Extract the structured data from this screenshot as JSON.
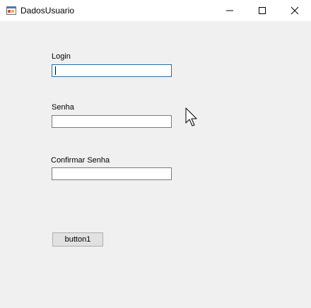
{
  "window": {
    "title": "DadosUsuario",
    "icon": "form-icon",
    "controls": [
      "minimize-icon",
      "maximize-icon",
      "close-icon"
    ]
  },
  "form": {
    "login_label": "Login",
    "login_value": "",
    "senha_label": "Senha",
    "senha_value": "",
    "confirmar_label": "Confirmar Senha",
    "confirmar_value": "",
    "button_label": "button1"
  },
  "colors": {
    "focus_border": "#0078d7",
    "client_background": "#f0f0f0",
    "button_face": "#e1e1e1"
  }
}
